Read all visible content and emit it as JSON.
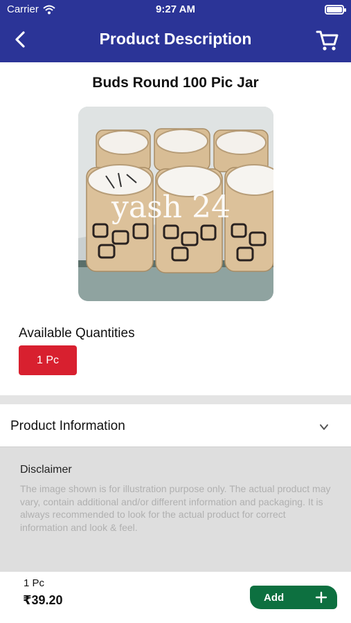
{
  "status_bar": {
    "carrier": "Carrier",
    "time": "9:27 AM"
  },
  "header": {
    "title": "Product Description"
  },
  "product": {
    "name": "Buds Round 100 Pic Jar",
    "image_icon": "product-photo-jars",
    "watermark": "yash 24"
  },
  "quantities": {
    "label": "Available Quantities",
    "options": [
      "1 Pc"
    ],
    "selected": "1 Pc"
  },
  "info": {
    "title": "Product Information"
  },
  "disclaimer": {
    "title": "Disclaimer",
    "text": "The image shown is for illustration purpose only. The actual product may vary, contain additional and/or different information and packaging. It is always recommended to look for the actual product for correct information and look & feel."
  },
  "footer": {
    "qty": "1 Pc",
    "price": "₹39.20",
    "add_label": "Add"
  },
  "colors": {
    "header": "#2b3497",
    "chip": "#d8202f",
    "add_button": "#0d7040"
  }
}
